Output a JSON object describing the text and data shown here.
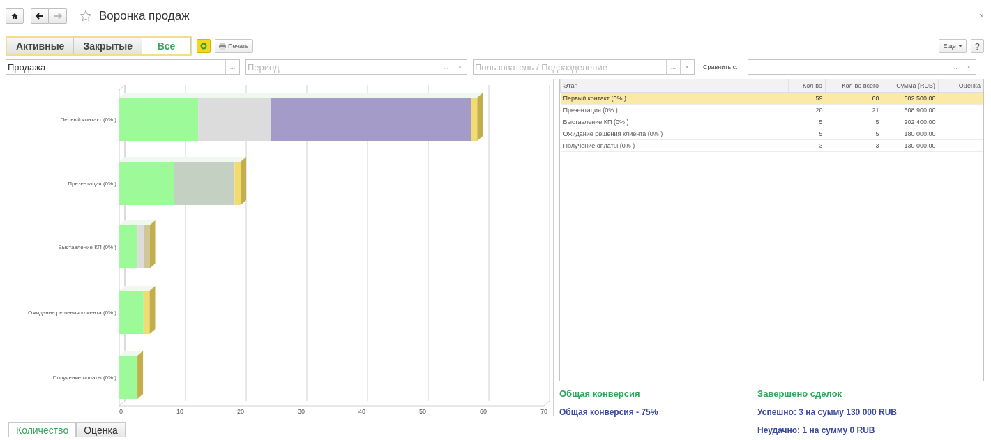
{
  "window": {
    "title": "Воронка продаж",
    "close": "×"
  },
  "toolbar": {
    "segments": [
      {
        "label": "Активные",
        "selected": false
      },
      {
        "label": "Закрытые",
        "selected": false
      },
      {
        "label": "Все",
        "selected": true
      }
    ],
    "print": "Печать",
    "more": "Еще",
    "help": "?"
  },
  "filters": {
    "deal": {
      "value": "Продажа",
      "button": "..."
    },
    "period": {
      "placeholder": "Период",
      "button": "...",
      "clear": "×"
    },
    "user": {
      "placeholder": "Пользователь / Подразделение",
      "button": "...",
      "clear": "×"
    },
    "compare": {
      "label": "Сравнить с:",
      "button": "...",
      "clear": "×"
    }
  },
  "chart": {
    "chart_data": {
      "type": "bar",
      "orientation": "horizontal",
      "stacked": true,
      "categories": [
        "Первый контакт (0% )",
        "Презентация (0% )",
        "Выставление КП (0% )",
        "Ожидание решения клиента (0% )",
        "Получение оплаты (0% )"
      ],
      "series": [
        {
          "color": "#9dfa98",
          "values": [
            13,
            9,
            3,
            4,
            3
          ]
        },
        {
          "color": "#dcdcdc",
          "values": [
            12,
            0,
            1,
            0,
            0
          ]
        },
        {
          "color": "#c3d0c2",
          "values": [
            0,
            10,
            0,
            0,
            0
          ]
        },
        {
          "color": "#a59bc9",
          "values": [
            33,
            0,
            0,
            0,
            0
          ]
        },
        {
          "color": "#cfc79a",
          "values": [
            0,
            0,
            1,
            0,
            0
          ]
        },
        {
          "color": "#f2dc70",
          "values": [
            1,
            1,
            0,
            1,
            0
          ]
        }
      ],
      "xlim": [
        0,
        70
      ],
      "xticks": [
        0,
        10,
        20,
        30,
        40,
        50,
        60,
        70
      ]
    }
  },
  "chart_tabs": [
    {
      "label": "Количество",
      "selected": true
    },
    {
      "label": "Оценка",
      "selected": false
    }
  ],
  "table": {
    "columns": [
      "Этап",
      "Кол-во",
      "Кол-во всего",
      "Сумма (RUB)",
      "Оценка"
    ],
    "rows": [
      {
        "cells": [
          "Первый контакт (0% )",
          "59",
          "60",
          "602 500,00"
        ],
        "selected": true
      },
      {
        "cells": [
          "Презентация (0% )",
          "20",
          "21",
          "508 900,00"
        ],
        "selected": false
      },
      {
        "cells": [
          "Выставление КП (0% )",
          "5",
          "5",
          "202 400,00"
        ],
        "selected": false
      },
      {
        "cells": [
          "Ожидание решения клиента (0% )",
          "5",
          "5",
          "180 000,00"
        ],
        "selected": false
      },
      {
        "cells": [
          "Получение оплаты (0% )",
          "3",
          "3",
          "130 000,00"
        ],
        "selected": false
      }
    ]
  },
  "summary": [
    {
      "heading": "Общая конверсия",
      "lines": [
        "Общая конверсия - 75%"
      ]
    },
    {
      "heading": "Завершено сделок",
      "lines": [
        "Успешно: 3 на сумму 130 000 RUB",
        "Неудачно: 1 на сумму 0 RUB"
      ]
    }
  ]
}
